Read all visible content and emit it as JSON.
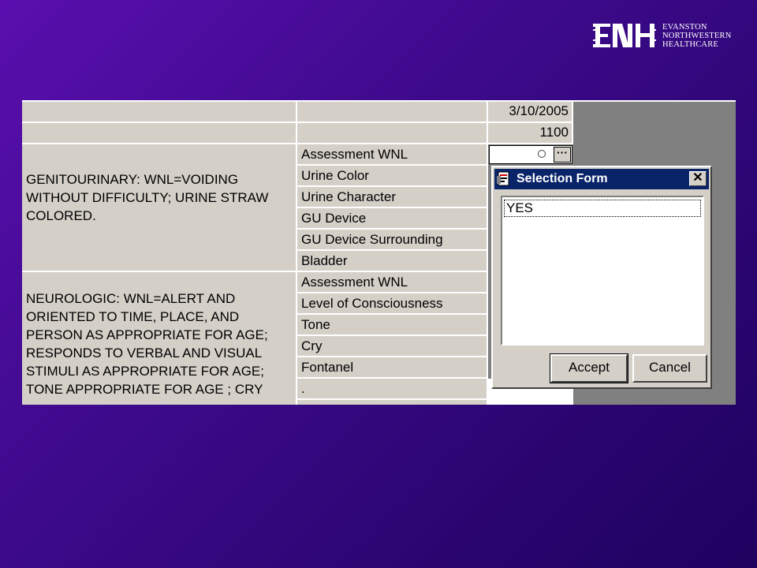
{
  "logo": {
    "line1": "EVANSTON",
    "line2": "NORTHWESTERN",
    "line3": "HEALTHCARE",
    "mark": "ENH"
  },
  "grid": {
    "date": "3/10/2005",
    "time": "1100",
    "genitourinary_desc": "GENITOURINARY: WNL=VOIDING WITHOUT DIFFICULTY; URINE STRAW COLORED.",
    "genitourinary_items": [
      "Assessment WNL",
      "Urine Color",
      "Urine Character",
      "GU Device",
      "GU Device Surrounding",
      "Bladder"
    ],
    "neurologic_desc": "NEUROLOGIC: WNL=ALERT AND ORIENTED TO TIME, PLACE, AND PERSON AS APPROPRIATE FOR AGE; RESPONDS TO VERBAL AND VISUAL STIMULI AS APPROPRIATE FOR AGE; TONE APPROPRIATE FOR AGE ; CRY",
    "neurologic_items": [
      "Assessment WNL",
      "Level of Consciousness",
      "Tone",
      "Cry",
      "Fontanel",
      "."
    ]
  },
  "dialog": {
    "title": "Selection Form",
    "close_label": "✕",
    "options": [
      "YES"
    ],
    "accept_label": "Accept",
    "cancel_label": "Cancel"
  },
  "combo": {
    "button_label": "···"
  }
}
